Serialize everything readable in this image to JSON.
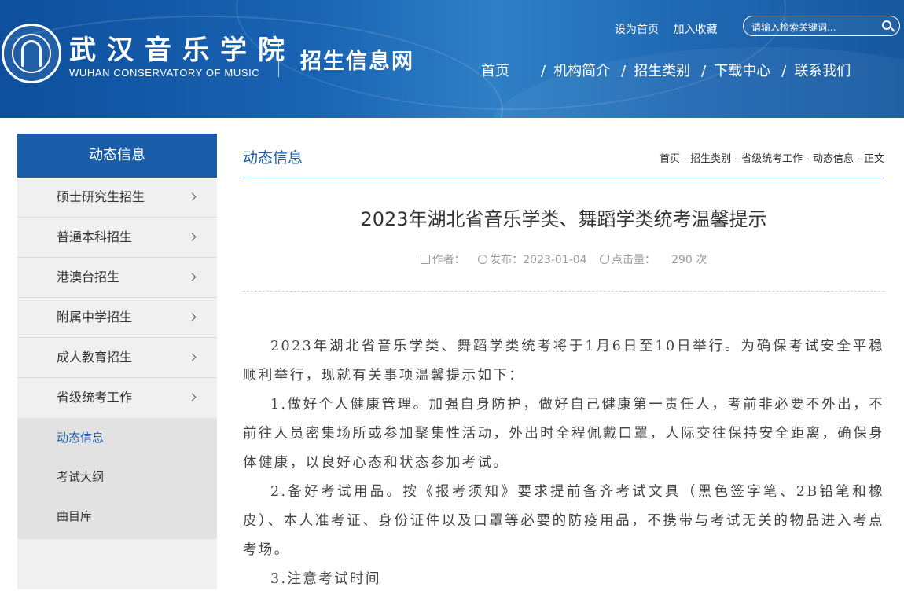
{
  "header": {
    "logo_cn": "武汉音乐学院",
    "logo_en": "WUHAN CONSERVATORY OF MUSIC",
    "site_name": "招生信息网",
    "top_links": [
      "设为首页",
      "加入收藏"
    ],
    "search_placeholder": "请输入检索关键词...",
    "nav": [
      "首页",
      "机构简介",
      "招生类别",
      "下载中心",
      "联系我们"
    ],
    "nav_separator": "/"
  },
  "sidebar": {
    "title": "动态信息",
    "items": [
      {
        "label": "硕士研究生招生"
      },
      {
        "label": "普通本科招生"
      },
      {
        "label": "港澳台招生"
      },
      {
        "label": "附属中学招生"
      },
      {
        "label": "成人教育招生"
      },
      {
        "label": "省级统考工作"
      }
    ],
    "sub_items": [
      {
        "label": "动态信息",
        "active": true
      },
      {
        "label": "考试大纲",
        "active": false
      },
      {
        "label": "曲目库",
        "active": false
      }
    ]
  },
  "content": {
    "section_title": "动态信息",
    "breadcrumb": "首页 - 招生类别 - 省级统考工作 - 动态信息 - 正文",
    "article_title": "2023年湖北省音乐学类、舞蹈学类统考温馨提示",
    "meta": {
      "author_label": "作者：",
      "publish_label": "发布：2023-01-04",
      "views_label": "点击量：",
      "views_count": "290 次"
    },
    "paragraphs": [
      "2023年湖北省音乐学类、舞蹈学类统考将于1月6日至10日举行。为确保考试安全平稳顺利举行，现就有关事项温馨提示如下：",
      "1.做好个人健康管理。加强自身防护，做好自己健康第一责任人，考前非必要不外出，不前往人员密集场所或参加聚集性活动，外出时全程佩戴口罩，人际交往保持安全距离，确保身体健康，以良好心态和状态参加考试。",
      "2.备好考试用品。按《报考须知》要求提前备齐考试文具（黑色签字笔、2B铅笔和橡皮）、本人准考证、身份证件以及口罩等必要的防疫用品，不携带与考试无关的物品进入考点考场。",
      "3.注意考试时间"
    ]
  },
  "colors": {
    "primary": "#1a5da8",
    "sidebar_bg": "#f0f0f0",
    "sub_bg": "#e2e2e2"
  }
}
